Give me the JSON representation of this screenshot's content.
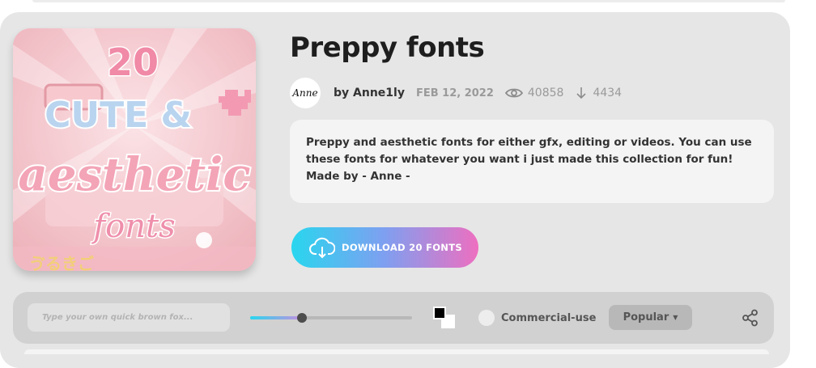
{
  "font_pack": {
    "title": "Preppy fonts",
    "avatar_text": "Anne",
    "author_label": "by Anne1ly",
    "date": "FEB 12, 2022",
    "views": "40858",
    "downloads": "4434",
    "description": "Preppy and aesthetic fonts for either gfx, editing or videos. You can use these fonts for whatever you want i just made this collection for fun! Made by - Anne -",
    "download_label": "DOWNLOAD 20 FONTS",
    "cover_text": {
      "number": "20",
      "line1": "CUTE &",
      "line2": "aesthetic",
      "line3": "fonts"
    }
  },
  "toolbar": {
    "preview_placeholder": "Type your own quick brown fox...",
    "size_slider_level": 0.32,
    "text_color": "#000000",
    "bg_color": "#ffffff",
    "commercial_label": "Commercial-use",
    "sort_label": "Popular",
    "icons": {
      "share": "share-icon",
      "sort_caret": "chevron-down-icon"
    }
  },
  "colors": {
    "card_bg": "#e6e6e6",
    "accent_start": "#29d6ef",
    "accent_end": "#ee6fc0"
  }
}
